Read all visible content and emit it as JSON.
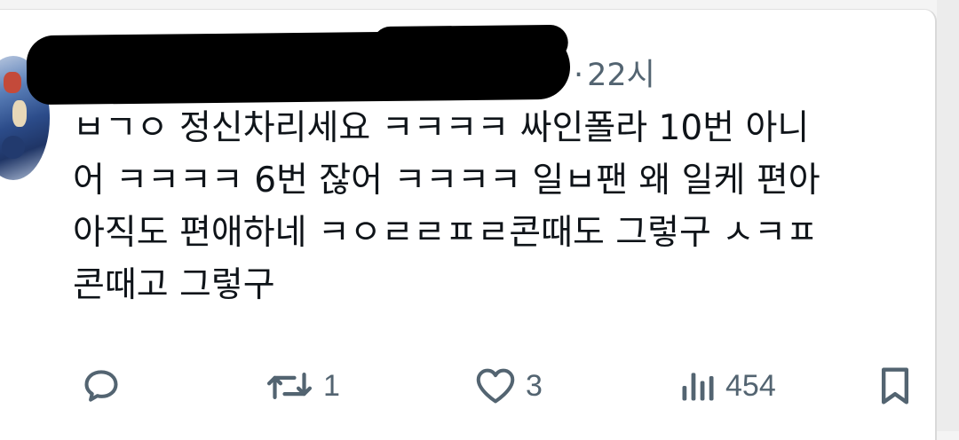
{
  "tweet": {
    "time": "22시",
    "separator": "·",
    "lines": [
      "ㅂㄱㅇ 정신차리세요 ㅋㅋㅋㅋ 싸인폴라 10번 아니",
      "어 ㅋㅋㅋㅋ 6번 잖어 ㅋㅋㅋㅋ 일ㅂ팬 왜 일케 편아",
      "아직도 편애하네 ㅋㅇㄹㄹㅍㄹ콘때도 그렇구 ㅅㅋㅍ",
      "콘때고 그렇구"
    ]
  },
  "actions": {
    "reply": {
      "icon": "reply-icon",
      "count": ""
    },
    "retweet": {
      "icon": "retweet-icon",
      "count": "1"
    },
    "like": {
      "icon": "heart-icon",
      "count": "3"
    },
    "views": {
      "icon": "views-icon",
      "count": "454"
    },
    "bookmark": {
      "icon": "bookmark-icon"
    }
  },
  "colors": {
    "text": "#0f1419",
    "secondary": "#536471",
    "background": "#ffffff"
  }
}
